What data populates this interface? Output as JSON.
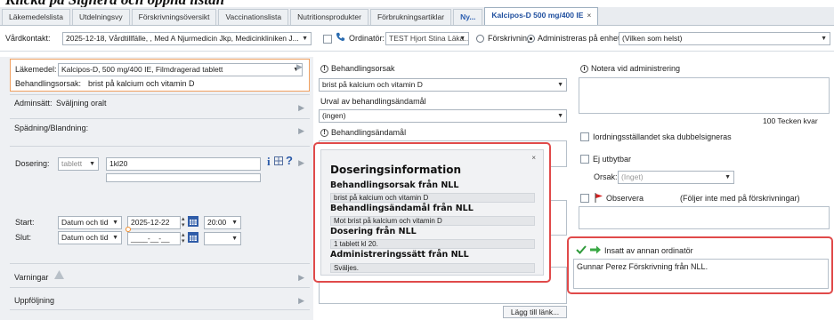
{
  "header": {
    "title": "Klicka på Signera och öppna listan"
  },
  "tabs": [
    {
      "label": "Läkemedelslista"
    },
    {
      "label": "Utdelningsvy"
    },
    {
      "label": "Förskrivningsöversikt"
    },
    {
      "label": "Vaccinationslista"
    },
    {
      "label": "Nutritionsprodukter"
    },
    {
      "label": "Förbrukningsartiklar"
    },
    {
      "label": "Ny..."
    },
    {
      "label": "Kalcipos-D 500 mg/400 IE"
    }
  ],
  "context": {
    "vardkontakt_label": "Vårdkontakt:",
    "vardkontakt_value": "2025-12-18, Vårdtillfälle, , Med A Njurmedicin Jkp, Medicinkliniken J...",
    "ordinator_label": "Ordinatör:",
    "ordinator_value": "TEST Hjort Stina Läka...",
    "forskrivning_label": "Förskrivning",
    "administreras_label": "Administreras på enhet:",
    "enhet_value": "(Vilken som helst)"
  },
  "left": {
    "lakemedel_label": "Läkemedel:",
    "lakemedel_value": "Kalcipos-D, 500 mg/400 IE, Filmdragerad tablett",
    "behandlingsorsak_label": "Behandlingsorsak:",
    "behandlingsorsak_value": "brist på kalcium och vitamin D",
    "adminsatt_label": "Adminsätt:",
    "adminsatt_value": "Sväljning oralt",
    "spadning_label": "Spädning/Blandning:",
    "dosering_label": "Dosering:",
    "dosering_form": "tablett",
    "dosering_value": "1kl20",
    "start_label": "Start:",
    "start_type": "Datum och tid",
    "start_date": "2025-12-22",
    "start_time": "20:00",
    "slut_label": "Slut:",
    "slut_type": "Datum och tid",
    "slut_date": "____-__-__",
    "varningar_label": "Varningar",
    "uppfoljning_label": "Uppföljning"
  },
  "middle": {
    "behandlingsorsak_label": "Behandlingsorsak",
    "behandlingsorsak_value": "brist på kalcium och vitamin D",
    "urval_label": "Urval av behandlingsändamål",
    "urval_value": "(ingen)",
    "andamal_label": "Behandlingsändamål",
    "lagg_till_lank": "Lägg till länk..."
  },
  "popup": {
    "title": "Doseringsinformation",
    "close": "×",
    "sections": [
      {
        "heading": "Behandlingsorsak från NLL",
        "value": "brist på kalcium och vitamin D"
      },
      {
        "heading": "Behandlingsändamål från NLL",
        "value": "Mot brist på kalcium och vitamin D"
      },
      {
        "heading": "Dosering från NLL",
        "value": "1 tablett kl 20."
      },
      {
        "heading": "Administreringssätt från NLL",
        "value": "Sväljes."
      }
    ]
  },
  "right": {
    "notera_label": "Notera vid administrering",
    "tecken_kvar": "100 Tecken kvar",
    "dubbelsignera_label": "Iordningsställandet ska dubbelsigneras",
    "ej_utbytbar_label": "Ej utbytbar",
    "orsak_label": "Orsak:",
    "orsak_value": "(Inget)",
    "observera_label": "Observera",
    "foljer_label": "(Följer inte med på förskrivningar)",
    "insatt_label": "Insatt av annan ordinatör",
    "insatt_value": "Gunnar Perez Förskrivning från NLL."
  },
  "colors": {
    "accent_blue": "#1f4f9e",
    "highlight_red": "#e04a4a",
    "orange_border": "#f0a060",
    "green_check": "#2f9a3a",
    "flag_red": "#d42020"
  }
}
